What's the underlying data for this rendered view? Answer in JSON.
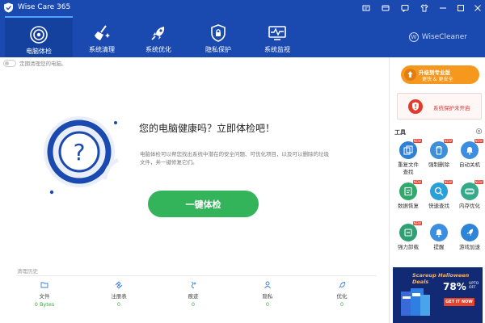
{
  "app": {
    "title": "Wise Care 365",
    "brand": "WiseCleaner",
    "brand_mark": "W"
  },
  "nav": {
    "tabs": [
      {
        "label": "电脑体检",
        "icon": "target-icon"
      },
      {
        "label": "系统清理",
        "icon": "broom-icon"
      },
      {
        "label": "系统优化",
        "icon": "rocket-icon"
      },
      {
        "label": "隐私保护",
        "icon": "shield-lock-icon"
      },
      {
        "label": "系统监视",
        "icon": "monitor-icon"
      }
    ]
  },
  "main": {
    "toggle_label": "定期清理您的电脑。",
    "headline": "您的电脑健康吗？立即体检吧！",
    "description": "电脑体检可以帮您找出系统中潜在的安全问题、可优化项目，以及可以删除的垃圾文件，并一键修复它们。",
    "scan_button": "一键体检",
    "history_label": "清理历史",
    "stats": [
      {
        "label": "文件",
        "value": "0 Bytes",
        "icon": "folder-icon"
      },
      {
        "label": "注册表",
        "value": "0",
        "icon": "registry-icon"
      },
      {
        "label": "痕迹",
        "value": "0",
        "icon": "trace-icon"
      },
      {
        "label": "隐私",
        "value": "0",
        "icon": "privacy-icon"
      },
      {
        "label": "优化",
        "value": "0",
        "icon": "optimize-icon"
      }
    ]
  },
  "side": {
    "upgrade_line1": "升级到专业版",
    "upgrade_line2": "更快 & 更安全",
    "protection_text": "系统保护未开启",
    "tools_title": "工具",
    "new_badge": "NEW",
    "tools": [
      {
        "label": "重复文件\n查找",
        "icon": "duplicate-files-icon",
        "color": "#2e7fd6",
        "new": true
      },
      {
        "label": "强制删除",
        "icon": "trash-icon",
        "color": "#3d8fd9",
        "new": true
      },
      {
        "label": "自动关机",
        "icon": "alarm-icon",
        "color": "#3c8fe0",
        "new": true
      },
      {
        "label": "数据恢复",
        "icon": "data-recovery-icon",
        "color": "#33a86b",
        "new": true
      },
      {
        "label": "快速查找",
        "icon": "search-icon",
        "color": "#2a9fd8",
        "new": true
      },
      {
        "label": "内存优化",
        "icon": "memory-icon",
        "color": "#35a98a",
        "new": true
      },
      {
        "label": "强力卸载",
        "icon": "uninstall-icon",
        "color": "#2f9f74",
        "new": true
      },
      {
        "label": "提醒",
        "icon": "bell-icon",
        "color": "#3c8fe0",
        "new": false
      },
      {
        "label": "游戏加速",
        "icon": "rocket-icon",
        "color": "#2d84d9",
        "new": false
      }
    ],
    "ad": {
      "title": "Scareup Halloween Deals",
      "percent": "78%",
      "upto": "UPTO\nOFF",
      "cta": "GET IT NOW"
    }
  },
  "colors": {
    "header": "#1a4ab0",
    "primary_green": "#34b45a",
    "upgrade_orange": "#f6971e",
    "warning_red": "#d33333"
  }
}
